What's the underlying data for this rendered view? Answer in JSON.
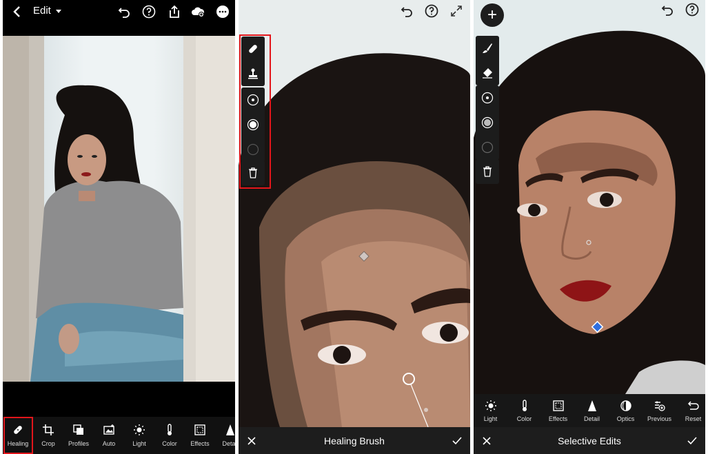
{
  "panel1": {
    "topbar": {
      "back_icon": "chevron-left-icon",
      "edit_label": "Edit",
      "edit_dropdown_icon": "caret-down-icon",
      "icons": [
        "undo-icon",
        "help-icon",
        "share-icon",
        "cloud-sync-icon",
        "more-icon"
      ]
    },
    "toolbar": [
      {
        "label": "Healing",
        "icon": "bandage-icon"
      },
      {
        "label": "Crop",
        "icon": "crop-icon"
      },
      {
        "label": "Profiles",
        "icon": "profiles-icon"
      },
      {
        "label": "Auto",
        "icon": "auto-icon"
      },
      {
        "label": "Light",
        "icon": "sun-icon"
      },
      {
        "label": "Color",
        "icon": "thermometer-icon"
      },
      {
        "label": "Effects",
        "icon": "effects-icon"
      },
      {
        "label": "Detail",
        "icon": "triangle-icon"
      }
    ],
    "highlight_color": "#e3161b"
  },
  "panel2": {
    "top_icons": [
      "undo-icon",
      "help-icon",
      "expand-icon"
    ],
    "side_tools": [
      "bandage-icon",
      "stamp-icon",
      "size-icon",
      "feather-icon",
      "opacity-icon",
      "trash-icon"
    ],
    "bottombar": {
      "title": "Healing Brush",
      "close_icon": "close-icon",
      "confirm_icon": "check-icon"
    }
  },
  "panel3": {
    "add_button": "+",
    "top_icons": [
      "undo-icon",
      "help-icon"
    ],
    "side_tools": [
      "brush-icon",
      "eraser-icon",
      "size-icon",
      "feather-icon",
      "flow-icon",
      "trash-icon"
    ],
    "toolbar": [
      {
        "label": "Light",
        "icon": "sun-icon"
      },
      {
        "label": "Color",
        "icon": "thermometer-icon"
      },
      {
        "label": "Effects",
        "icon": "effects-icon"
      },
      {
        "label": "Detail",
        "icon": "triangle-icon"
      },
      {
        "label": "Optics",
        "icon": "optics-icon"
      },
      {
        "label": "Previous",
        "icon": "previous-icon"
      },
      {
        "label": "Reset",
        "icon": "reset-icon"
      }
    ],
    "bottombar": {
      "title": "Selective Edits",
      "close_icon": "close-icon",
      "confirm_icon": "check-icon"
    },
    "pin_color": "#2f6fe0"
  }
}
